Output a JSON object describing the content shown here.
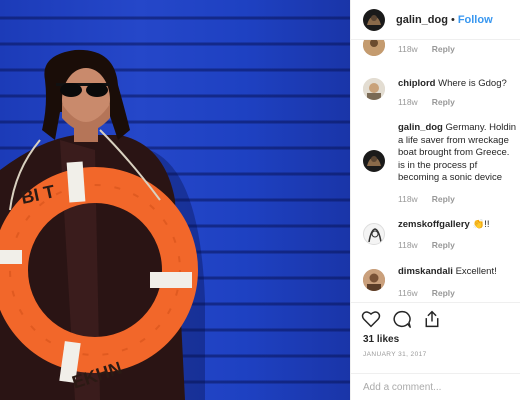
{
  "post": {
    "author": "galin_dog",
    "separator": "•",
    "follow_label": "Follow",
    "photo_subject": "man-with-orange-lifebuoy",
    "lifebuoy_text_top": "BI T",
    "lifebuoy_text_bottom": "EKHN"
  },
  "comments": [
    {
      "user": "",
      "text": "",
      "time": "118w",
      "reply": "Reply"
    },
    {
      "user": "chiplord",
      "text": "Where is Gdog?",
      "time": "118w",
      "reply": "Reply"
    },
    {
      "user": "galin_dog",
      "lines": [
        "Germany. Holdin",
        "a life saver from wreckage",
        "boat brought from Greece.",
        "is in the process pf",
        "becoming a sonic device"
      ],
      "time": "118w",
      "reply": "Reply"
    },
    {
      "user": "zemskoffgallery",
      "text": "👏!!",
      "time": "118w",
      "reply": "Reply"
    },
    {
      "user": "dimskandali",
      "text": "Excellent!",
      "time": "116w",
      "reply": "Reply"
    }
  ],
  "actions": {
    "like_icon": "heart-icon",
    "comment_icon": "comment-bubble-icon",
    "share_icon": "share-icon",
    "likes": "31 likes",
    "date": "JANUARY 31, 2017"
  },
  "compose": {
    "placeholder": "Add a comment..."
  },
  "colors": {
    "accent": "#3897f0",
    "wall_blue": "#2547c9",
    "lifebuoy_orange": "#f2672a"
  }
}
